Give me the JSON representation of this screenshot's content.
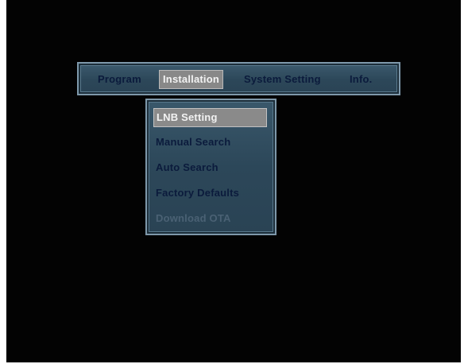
{
  "menubar": {
    "items": [
      {
        "label": "Program"
      },
      {
        "label": "Installation",
        "selected": true
      },
      {
        "label": "System Setting"
      },
      {
        "label": "Info."
      }
    ]
  },
  "dropdown": {
    "items": [
      {
        "label": "LNB Setting",
        "selected": true
      },
      {
        "label": "Manual Search"
      },
      {
        "label": "Auto Search"
      },
      {
        "label": "Factory Defaults"
      },
      {
        "label": "Download OTA",
        "disabled": true
      }
    ]
  },
  "colors": {
    "background": "#030303",
    "panel": "#2c4759",
    "panel_border": "#7e98aa",
    "text": "#0b1b3c",
    "highlight": "#888888",
    "highlight_text": "#f2f2f2",
    "disabled_text": "#4a6174"
  }
}
